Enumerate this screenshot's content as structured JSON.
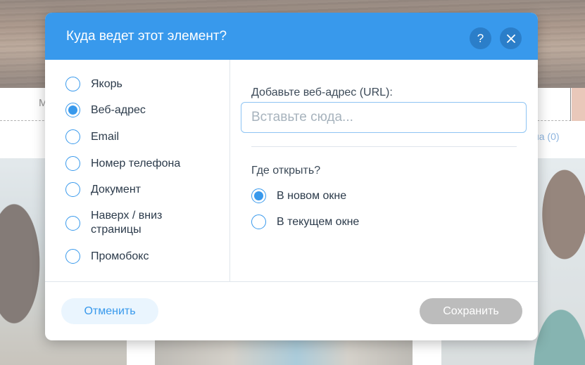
{
  "background": {
    "menu_item": "М",
    "cart_link": "на (0)"
  },
  "dialog": {
    "title": "Куда ведет этот элемент?",
    "help_label": "?",
    "link_types": [
      {
        "label": "Якорь",
        "checked": false
      },
      {
        "label": "Веб-адрес",
        "checked": true
      },
      {
        "label": "Email",
        "checked": false
      },
      {
        "label": "Номер телефона",
        "checked": false
      },
      {
        "label": "Документ",
        "checked": false
      },
      {
        "label": "Наверх / вниз страницы",
        "checked": false
      },
      {
        "label": "Промобокс",
        "checked": false
      }
    ],
    "url": {
      "label": "Добавьте веб-адрес (URL):",
      "placeholder": "Вставьте сюда...",
      "value": ""
    },
    "open_in": {
      "label": "Где открыть?",
      "options": [
        {
          "label": "В новом окне",
          "checked": true
        },
        {
          "label": "В текущем окне",
          "checked": false
        }
      ]
    },
    "cancel_label": "Отменить",
    "save_label": "Сохранить"
  },
  "colors": {
    "accent": "#3899ec",
    "save_disabled": "#bcbcbc"
  }
}
